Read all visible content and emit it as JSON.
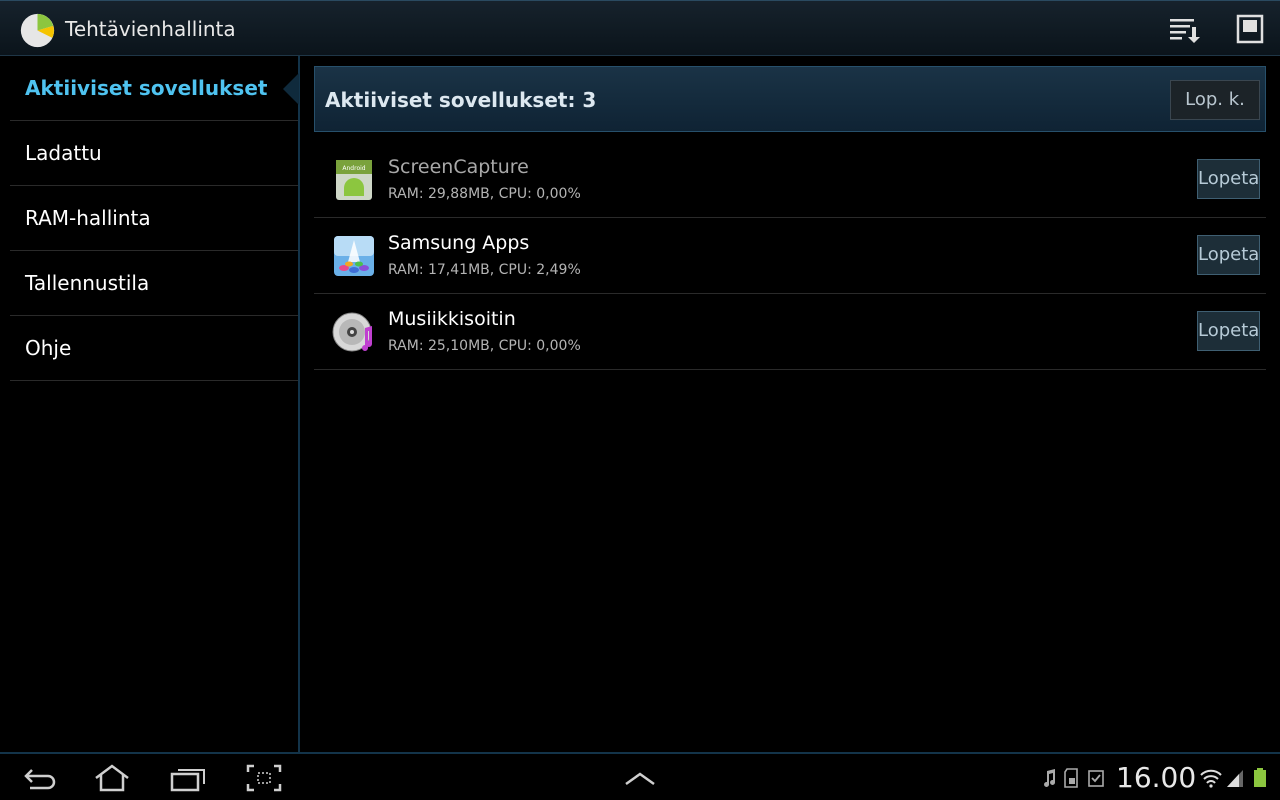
{
  "app": {
    "title": "Tehtävienhallinta",
    "icons": [
      "task-manager-pie-icon",
      "sort-icon",
      "window-icon"
    ]
  },
  "sidebar": {
    "items": [
      {
        "label": "Aktiiviset sovellukset",
        "active": true
      },
      {
        "label": "Ladattu",
        "active": false
      },
      {
        "label": "RAM-hallinta",
        "active": false
      },
      {
        "label": "Tallennustila",
        "active": false
      },
      {
        "label": "Ohje",
        "active": false
      }
    ]
  },
  "main": {
    "header_title": "Aktiiviset sovellukset: 3",
    "end_all_label": "Lop. k.",
    "apps": [
      {
        "name": "ScreenCapture",
        "stats": "RAM: 29,88MB, CPU: 0,00%",
        "button": "Lopeta",
        "icon": "android-app-icon"
      },
      {
        "name": "Samsung Apps",
        "stats": "RAM: 17,41MB, CPU: 2,49%",
        "button": "Lopeta",
        "icon": "samsung-apps-icon"
      },
      {
        "name": "Musiikkisoitin",
        "stats": "RAM: 25,10MB, CPU: 0,00%",
        "button": "Lopeta",
        "icon": "music-player-icon"
      }
    ]
  },
  "sysbar": {
    "clock": "16.00",
    "icons": [
      "back-icon",
      "home-icon",
      "recent-apps-icon",
      "screenshot-icon",
      "expand-up-icon",
      "music-note-icon",
      "sd-card-icon",
      "clipboard-check-icon",
      "wifi-icon",
      "signal-icon",
      "battery-icon"
    ]
  },
  "colors": {
    "accent": "#4fc3f0",
    "header_bg": "#1a3346",
    "stop_button_bg": "#1d2e38"
  }
}
